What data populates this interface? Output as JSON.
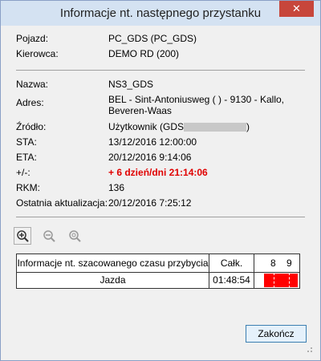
{
  "window": {
    "title": "Informacje nt. następnego przystanku",
    "close_glyph": "✕"
  },
  "vehicle": {
    "vehicle_label": "Pojazd:",
    "vehicle_value": "PC_GDS (PC_GDS)",
    "driver_label": "Kierowca:",
    "driver_value": "DEMO RD (200)"
  },
  "stop": {
    "name_label": "Nazwa:",
    "name_value": "NS3_GDS",
    "address_label": "Adres:",
    "address_line1": "BEL - Sint-Antoniusweg ( ) - 9130 - Kallo,",
    "address_line2": "Beveren-Waas",
    "source_label": "Źródło:",
    "source_value": "Użytkownik (GDS",
    "source_suffix": ")",
    "sta_label": "STA:",
    "sta_value": "13/12/2016 12:00:00",
    "eta_label": "ETA:",
    "eta_value": "20/12/2016 9:14:06",
    "delta_label": "+/-:",
    "delta_value": "+ 6 dzień/dni 21:14:06",
    "rkm_label": "RKM:",
    "rkm_value": "136",
    "updated_label": "Ostatnia aktualizacja:",
    "updated_value": "20/12/2016 7:25:12",
    "delta_color": "#e00000"
  },
  "toolbar": {
    "zoom_in_icon": "zoom-in-icon",
    "zoom_out_icon": "zoom-out-icon",
    "zoom_fit_icon": "zoom-fit-icon"
  },
  "estimate_table": {
    "header_label": "Informacje nt. szacowanego czasu przybycia",
    "total_header": "Całk.",
    "hour_labels": [
      "8",
      "9"
    ],
    "row_label": "Jazda",
    "row_total": "01:48:54",
    "bar_color": "#ff0000"
  },
  "footer": {
    "finish_label": "Zakończ"
  }
}
